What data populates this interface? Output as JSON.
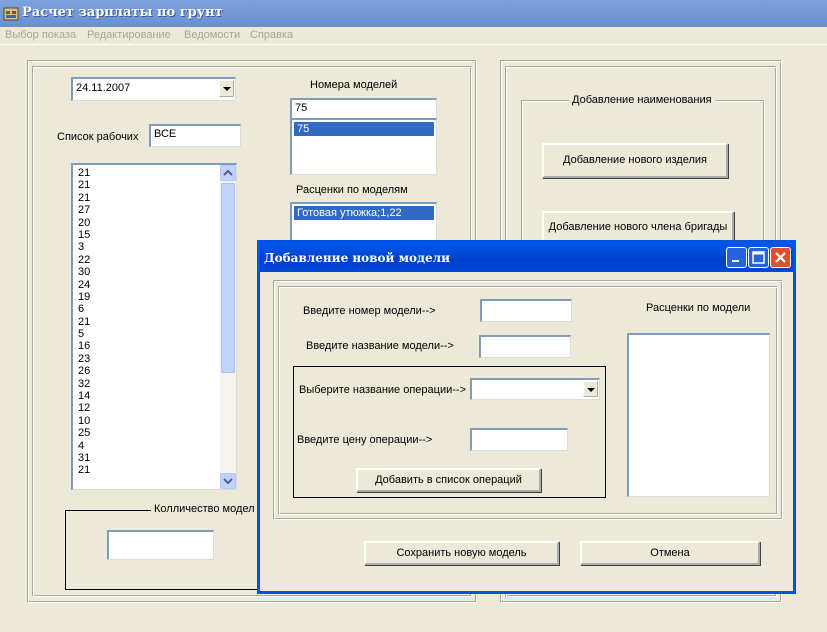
{
  "window": {
    "title": "Расчет зарплаты по грунт"
  },
  "menu": [
    "Выбор показа",
    "Редактирование",
    "Ведомости",
    "Справка"
  ],
  "left_panel": {
    "date_value": "24.11.2007",
    "workers_label": "Список рабочих",
    "workers_filter": "ВСЕ",
    "workers_list": [
      "21",
      "21",
      "21",
      "27",
      "20",
      "15",
      "3",
      "22",
      "30",
      "24",
      "19",
      "6",
      "21",
      "5",
      "16",
      "23",
      "26",
      "32",
      "14",
      "12",
      "10",
      "25",
      "4",
      "31",
      "21"
    ],
    "models_label": "Номера моделей",
    "model_input": "75",
    "models_list": [
      "75"
    ],
    "rates_label": "Расценки  по моделям",
    "rates_list": [
      "Готовая утюжка;1,22"
    ],
    "count_label": "Колличество модел"
  },
  "right_panel": {
    "group_label": "Добавление наименования",
    "add_product_label": "Добавление нового изделия",
    "add_member_label": "Добавление нового члена бригады"
  },
  "dialog": {
    "title": "Добавление  новой модели",
    "model_number_label": "Введите номер модели-->",
    "model_name_label": "Введите название модели-->",
    "operation_label": "Выберите название  операции-->",
    "price_label": "Введите цену операции-->",
    "add_to_list_label": "Добавить в список операций",
    "rates_label": "Расценки по модели",
    "save_label": "Сохранить новую модель",
    "cancel_label": "Отмена"
  }
}
